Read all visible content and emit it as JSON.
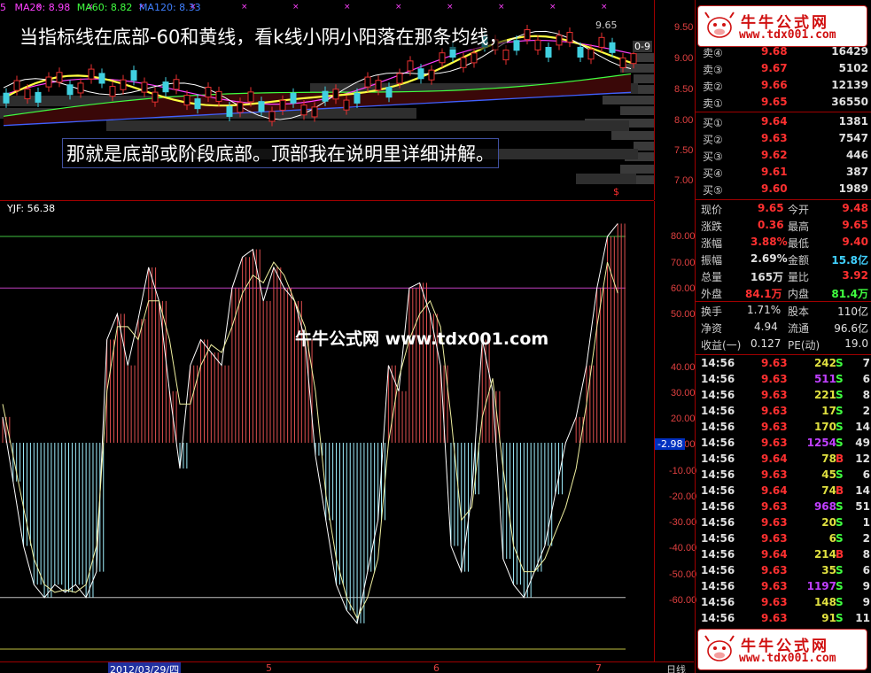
{
  "colors": {
    "up": "#e83030",
    "down": "#40d0e0",
    "ma5": "#ffffff",
    "ma10": "#ffff40",
    "ma20": "#ff40ff",
    "ma60": "#40ff40",
    "ma120": "#4060ff",
    "grid": "#a00000",
    "label_red": "#ff3030",
    "label_green": "#40ff40",
    "label_white": "#ffffff",
    "label_cyan": "#40d0ff",
    "label_purple": "#c040ff"
  },
  "top_pane": {
    "legend": {
      "prefix": "5",
      "ma20": "MA20: 8.98",
      "ma60": "MA60: 8.82",
      "ma120": "MA120: 8.33"
    },
    "annotation_line1": "当指标线在底部-60和黄线，看k线小阴小阳落在那条均线，",
    "annotation_line2": "那就是底部或阶段底部。顶部我在说明里详细讲解。",
    "price_label_high": "9.65",
    "price_label_box": "0-9",
    "axis_ticks": [
      "9.50",
      "9.00",
      "8.50",
      "8.00",
      "7.50",
      "7.00"
    ],
    "marker": "$"
  },
  "bottom_pane": {
    "indicator_label": "YJF: 56.38",
    "axis_ticks": [
      "80.00",
      "70.00",
      "60.00",
      "50.00",
      "40.00",
      "30.00",
      "20.00",
      "10.00",
      "-10.00",
      "-20.00",
      "-30.00",
      "-40.00",
      "-50.00",
      "-60.00"
    ],
    "current_value_tag": "-2.98",
    "watermark_text": "牛牛公式网 www.tdx001.com"
  },
  "timeline": {
    "date_label": "2012/03/29/四",
    "month_5": "5",
    "month_6": "6",
    "month_7": "7",
    "period": "日线"
  },
  "order_book": {
    "asks": [
      {
        "label": "卖④",
        "price": "9.68",
        "vol": "16429"
      },
      {
        "label": "卖③",
        "price": "9.67",
        "vol": "5102"
      },
      {
        "label": "卖②",
        "price": "9.66",
        "vol": "12139"
      },
      {
        "label": "卖①",
        "price": "9.65",
        "vol": "36550"
      }
    ],
    "bids": [
      {
        "label": "买①",
        "price": "9.64",
        "vol": "1381"
      },
      {
        "label": "买②",
        "price": "9.63",
        "vol": "7547"
      },
      {
        "label": "买③",
        "price": "9.62",
        "vol": "446"
      },
      {
        "label": "买④",
        "price": "9.61",
        "vol": "387"
      },
      {
        "label": "买⑤",
        "price": "9.60",
        "vol": "1989"
      }
    ]
  },
  "quote": [
    {
      "l1": "现价",
      "v1": "9.65",
      "l2": "今开",
      "v2": "9.48"
    },
    {
      "l1": "涨跌",
      "v1": "0.36",
      "l2": "最高",
      "v2": "9.65"
    },
    {
      "l1": "涨幅",
      "v1": "3.88%",
      "l2": "最低",
      "v2": "9.40"
    },
    {
      "l1": "振幅",
      "v1": "2.69%",
      "l2": "金额",
      "v2": "15.8亿"
    },
    {
      "l1": "总量",
      "v1": "165万",
      "l2": "量比",
      "v2": "3.92"
    },
    {
      "l1": "外盘",
      "v1": "84.1万",
      "l2": "内盘",
      "v2": "81.4万"
    }
  ],
  "finance": [
    {
      "l1": "换手",
      "v1": "1.71%",
      "l2": "股本",
      "v2": "110亿"
    },
    {
      "l1": "净资",
      "v1": "4.94",
      "l2": "流通",
      "v2": "96.6亿"
    },
    {
      "l1": "收益(一)",
      "v1": "0.127",
      "l2": "PE(动)",
      "v2": "19.0"
    }
  ],
  "trades": [
    {
      "time": "14:56",
      "price": "9.63",
      "vol": "242",
      "side": "S",
      "n": "7"
    },
    {
      "time": "14:56",
      "price": "9.63",
      "vol": "511",
      "side": "S",
      "n": "6"
    },
    {
      "time": "14:56",
      "price": "9.63",
      "vol": "221",
      "side": "S",
      "n": "8"
    },
    {
      "time": "14:56",
      "price": "9.63",
      "vol": "17",
      "side": "S",
      "n": "2"
    },
    {
      "time": "14:56",
      "price": "9.63",
      "vol": "170",
      "side": "S",
      "n": "14"
    },
    {
      "time": "14:56",
      "price": "9.63",
      "vol": "1254",
      "side": "S",
      "n": "49"
    },
    {
      "time": "14:56",
      "price": "9.64",
      "vol": "78",
      "side": "B",
      "n": "12"
    },
    {
      "time": "14:56",
      "price": "9.63",
      "vol": "45",
      "side": "S",
      "n": "6"
    },
    {
      "time": "14:56",
      "price": "9.64",
      "vol": "74",
      "side": "B",
      "n": "14"
    },
    {
      "time": "14:56",
      "price": "9.63",
      "vol": "968",
      "side": "S",
      "n": "51"
    },
    {
      "time": "14:56",
      "price": "9.63",
      "vol": "20",
      "side": "S",
      "n": "1"
    },
    {
      "time": "14:56",
      "price": "9.63",
      "vol": "6",
      "side": "S",
      "n": "2"
    },
    {
      "time": "14:56",
      "price": "9.64",
      "vol": "214",
      "side": "B",
      "n": "8"
    },
    {
      "time": "14:56",
      "price": "9.63",
      "vol": "35",
      "side": "S",
      "n": "6"
    },
    {
      "time": "14:56",
      "price": "9.63",
      "vol": "1197",
      "side": "S",
      "n": "9"
    },
    {
      "time": "14:56",
      "price": "9.63",
      "vol": "148",
      "side": "S",
      "n": "9"
    },
    {
      "time": "14:56",
      "price": "9.63",
      "vol": "91",
      "side": "S",
      "n": "11"
    }
  ],
  "watermark": {
    "cn": "牛牛公式网",
    "url": "www.tdx001.com"
  },
  "indicator_series": {
    "histogram": [
      10,
      -15,
      -40,
      -55,
      -60,
      -55,
      -58,
      -55,
      -60,
      -50,
      40,
      50,
      30,
      48,
      68,
      55,
      20,
      -10,
      30,
      40,
      35,
      30,
      60,
      72,
      75,
      55,
      68,
      60,
      55,
      40,
      -5,
      -30,
      -55,
      -65,
      -70,
      -50,
      -30,
      30,
      20,
      60,
      62,
      50,
      30,
      -40,
      -50,
      -20,
      40,
      20,
      -45,
      -55,
      -60,
      -50,
      -40,
      -20,
      0,
      10,
      30,
      60,
      80,
      85
    ],
    "line": [
      15,
      -5,
      -25,
      -45,
      -55,
      -58,
      -57,
      -58,
      -55,
      -40,
      20,
      45,
      45,
      40,
      55,
      55,
      40,
      15,
      15,
      30,
      38,
      35,
      45,
      58,
      65,
      62,
      70,
      65,
      55,
      45,
      20,
      -20,
      -45,
      -60,
      -68,
      -60,
      -45,
      0,
      25,
      40,
      50,
      55,
      45,
      10,
      -30,
      -25,
      10,
      25,
      -10,
      -40,
      -50,
      -50,
      -45,
      -35,
      -25,
      -10,
      15,
      45,
      70,
      58
    ]
  }
}
